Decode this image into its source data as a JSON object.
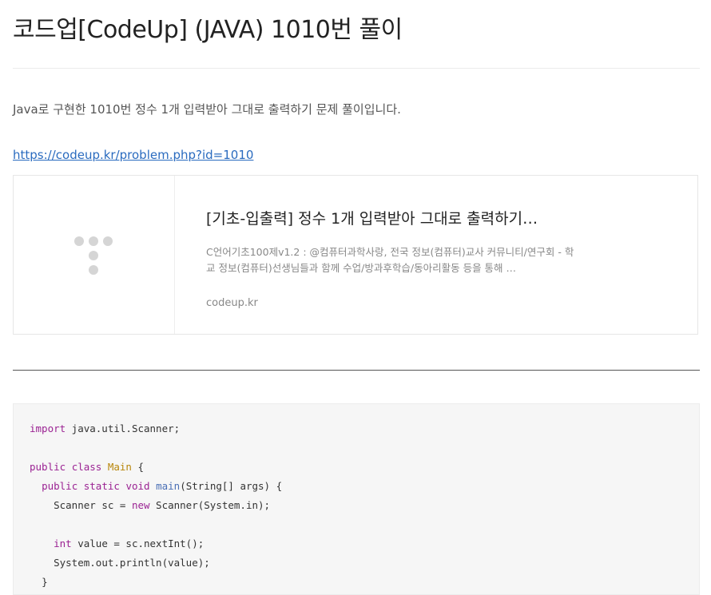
{
  "post": {
    "title": "코드업[CodeUp] (JAVA) 1010번 풀이",
    "intro": "Java로 구현한 1010번 정수 1개 입력받아 그대로 출력하기 문제 풀이입니다.",
    "link_text": "https://codeup.kr/problem.php?id=1010"
  },
  "og_card": {
    "title": "[기초-입출력] 정수 1개 입력받아 그대로 출력하기…",
    "description": "C언어기초100제v1.2 : @컴퓨터과학사랑, 전국 정보(컴퓨터)교사 커뮤니티/연구회 - 학교 정보(컴퓨터)선생님들과 함께 수업/방과후학습/동아리활동 등을 통해 …",
    "domain": "codeup.kr",
    "thumb_icon": "placeholder-dots-icon"
  },
  "code": {
    "l1_kw": "import",
    "l1_rest": " java.util.Scanner;",
    "l3_kw1": "public",
    "l3_kw2": "class",
    "l3_type": "Main",
    "l3_rest": " {",
    "l4_kw1": "public",
    "l4_kw2": "static",
    "l4_kw3": "void",
    "l4_fn": "main",
    "l4_rest": "(String[] args) {",
    "l5_a": "Scanner sc = ",
    "l5_kw": "new",
    "l5_b": " Scanner(System.in);",
    "l7_kw": "int",
    "l7_rest": " value = sc.nextInt();",
    "l8": "System.out.println(value);",
    "l9": "}"
  },
  "colors": {
    "link": "#2a6bbf",
    "keyword": "#9b2393",
    "type": "#b8860b",
    "function": "#4a6fb5"
  }
}
